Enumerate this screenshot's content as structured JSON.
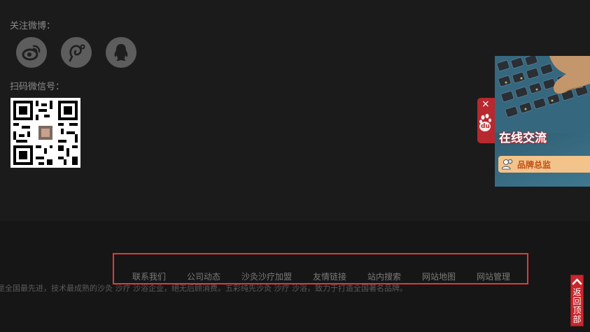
{
  "follow": {
    "weibo_label": "关注微博："
  },
  "social_icons": [
    "weibo-icon",
    "tencent-weibo-icon",
    "qq-icon"
  ],
  "wechat": {
    "scan_label": "扫码微信号："
  },
  "footer": {
    "links": [
      "联系我们",
      "公司动态",
      "沙灸沙疗加盟",
      "友情链接",
      "站内搜索",
      "网站地图",
      "网站管理"
    ],
    "blurb": "是全国最先进，技术最成熟的沙灸 沙疗 沙浴企业，絕无后顾消费。五彩纯先沙灸 沙疗 沙浴，致力于打造全国著名品牌。"
  },
  "chat_widget": {
    "title": "在线交流",
    "brand_label": "品牌总监",
    "close_label": "×",
    "tab_logo": "du"
  },
  "back_to_top": {
    "label": "返回顶部"
  },
  "colors": {
    "accent_red": "#e03a3a",
    "chat_orange": "#f2c38b",
    "background": "#1b1b1b"
  }
}
